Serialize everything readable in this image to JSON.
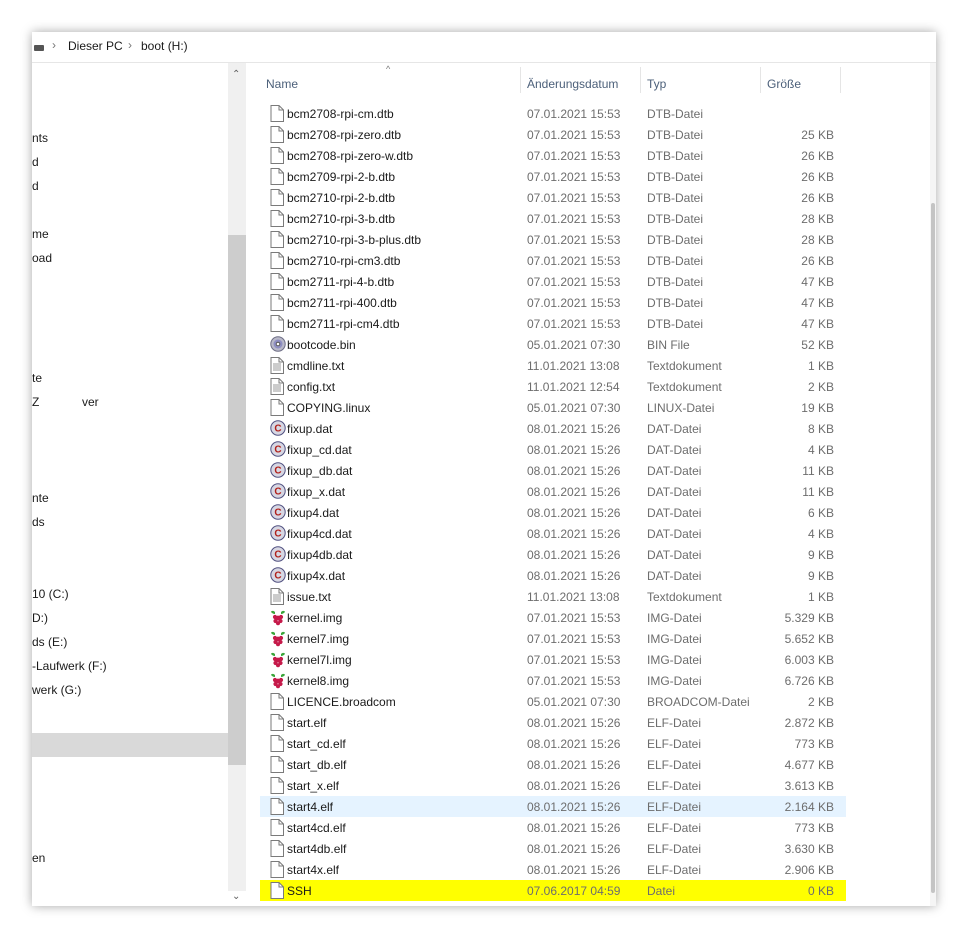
{
  "breadcrumb": {
    "crumb1": "Dieser PC",
    "crumb2": "boot (H:)"
  },
  "nav": {
    "items": [
      "nts",
      "d",
      "d",
      "me",
      "oad",
      "te",
      "Z",
      "ver",
      "nte",
      "ds",
      "10 (C:)",
      "D:)",
      "ds (E:)",
      "-Laufwerk (F:)",
      "werk (G:)",
      "en"
    ]
  },
  "scroll": {
    "up": "⌃",
    "down": "⌄"
  },
  "columns": {
    "name": "Name",
    "date": "Änderungsdatum",
    "type": "Typ",
    "size": "Größe",
    "sort_indicator": "^"
  },
  "files": [
    {
      "name": "bcm2708-rpi-cm.dtb",
      "date": "07.01.2021 15:53",
      "type": "DTB-Datei",
      "size": "",
      "icon": "file"
    },
    {
      "name": "bcm2708-rpi-zero.dtb",
      "date": "07.01.2021 15:53",
      "type": "DTB-Datei",
      "size": "25 KB",
      "icon": "file"
    },
    {
      "name": "bcm2708-rpi-zero-w.dtb",
      "date": "07.01.2021 15:53",
      "type": "DTB-Datei",
      "size": "26 KB",
      "icon": "file"
    },
    {
      "name": "bcm2709-rpi-2-b.dtb",
      "date": "07.01.2021 15:53",
      "type": "DTB-Datei",
      "size": "26 KB",
      "icon": "file"
    },
    {
      "name": "bcm2710-rpi-2-b.dtb",
      "date": "07.01.2021 15:53",
      "type": "DTB-Datei",
      "size": "26 KB",
      "icon": "file"
    },
    {
      "name": "bcm2710-rpi-3-b.dtb",
      "date": "07.01.2021 15:53",
      "type": "DTB-Datei",
      "size": "28 KB",
      "icon": "file"
    },
    {
      "name": "bcm2710-rpi-3-b-plus.dtb",
      "date": "07.01.2021 15:53",
      "type": "DTB-Datei",
      "size": "28 KB",
      "icon": "file"
    },
    {
      "name": "bcm2710-rpi-cm3.dtb",
      "date": "07.01.2021 15:53",
      "type": "DTB-Datei",
      "size": "26 KB",
      "icon": "file"
    },
    {
      "name": "bcm2711-rpi-4-b.dtb",
      "date": "07.01.2021 15:53",
      "type": "DTB-Datei",
      "size": "47 KB",
      "icon": "file"
    },
    {
      "name": "bcm2711-rpi-400.dtb",
      "date": "07.01.2021 15:53",
      "type": "DTB-Datei",
      "size": "47 KB",
      "icon": "file"
    },
    {
      "name": "bcm2711-rpi-cm4.dtb",
      "date": "07.01.2021 15:53",
      "type": "DTB-Datei",
      "size": "47 KB",
      "icon": "file"
    },
    {
      "name": "bootcode.bin",
      "date": "05.01.2021 07:30",
      "type": "BIN File",
      "size": "52 KB",
      "icon": "disc"
    },
    {
      "name": "cmdline.txt",
      "date": "11.01.2021 13:08",
      "type": "Textdokument",
      "size": "1 KB",
      "icon": "text"
    },
    {
      "name": "config.txt",
      "date": "11.01.2021 12:54",
      "type": "Textdokument",
      "size": "2 KB",
      "icon": "text"
    },
    {
      "name": "COPYING.linux",
      "date": "05.01.2021 07:30",
      "type": "LINUX-Datei",
      "size": "19 KB",
      "icon": "file"
    },
    {
      "name": "fixup.dat",
      "date": "08.01.2021 15:26",
      "type": "DAT-Datei",
      "size": "8 KB",
      "icon": "ccleaner"
    },
    {
      "name": "fixup_cd.dat",
      "date": "08.01.2021 15:26",
      "type": "DAT-Datei",
      "size": "4 KB",
      "icon": "ccleaner"
    },
    {
      "name": "fixup_db.dat",
      "date": "08.01.2021 15:26",
      "type": "DAT-Datei",
      "size": "11 KB",
      "icon": "ccleaner"
    },
    {
      "name": "fixup_x.dat",
      "date": "08.01.2021 15:26",
      "type": "DAT-Datei",
      "size": "11 KB",
      "icon": "ccleaner"
    },
    {
      "name": "fixup4.dat",
      "date": "08.01.2021 15:26",
      "type": "DAT-Datei",
      "size": "6 KB",
      "icon": "ccleaner"
    },
    {
      "name": "fixup4cd.dat",
      "date": "08.01.2021 15:26",
      "type": "DAT-Datei",
      "size": "4 KB",
      "icon": "ccleaner"
    },
    {
      "name": "fixup4db.dat",
      "date": "08.01.2021 15:26",
      "type": "DAT-Datei",
      "size": "9 KB",
      "icon": "ccleaner"
    },
    {
      "name": "fixup4x.dat",
      "date": "08.01.2021 15:26",
      "type": "DAT-Datei",
      "size": "9 KB",
      "icon": "ccleaner"
    },
    {
      "name": "issue.txt",
      "date": "11.01.2021 13:08",
      "type": "Textdokument",
      "size": "1 KB",
      "icon": "text"
    },
    {
      "name": "kernel.img",
      "date": "07.01.2021 15:53",
      "type": "IMG-Datei",
      "size": "5.329 KB",
      "icon": "raspberry"
    },
    {
      "name": "kernel7.img",
      "date": "07.01.2021 15:53",
      "type": "IMG-Datei",
      "size": "5.652 KB",
      "icon": "raspberry"
    },
    {
      "name": "kernel7l.img",
      "date": "07.01.2021 15:53",
      "type": "IMG-Datei",
      "size": "6.003 KB",
      "icon": "raspberry"
    },
    {
      "name": "kernel8.img",
      "date": "07.01.2021 15:53",
      "type": "IMG-Datei",
      "size": "6.726 KB",
      "icon": "raspberry"
    },
    {
      "name": "LICENCE.broadcom",
      "date": "05.01.2021 07:30",
      "type": "BROADCOM-Datei",
      "size": "2 KB",
      "icon": "file"
    },
    {
      "name": "start.elf",
      "date": "08.01.2021 15:26",
      "type": "ELF-Datei",
      "size": "2.872 KB",
      "icon": "file"
    },
    {
      "name": "start_cd.elf",
      "date": "08.01.2021 15:26",
      "type": "ELF-Datei",
      "size": "773 KB",
      "icon": "file"
    },
    {
      "name": "start_db.elf",
      "date": "08.01.2021 15:26",
      "type": "ELF-Datei",
      "size": "4.677 KB",
      "icon": "file"
    },
    {
      "name": "start_x.elf",
      "date": "08.01.2021 15:26",
      "type": "ELF-Datei",
      "size": "3.613 KB",
      "icon": "file"
    },
    {
      "name": "start4.elf",
      "date": "08.01.2021 15:26",
      "type": "ELF-Datei",
      "size": "2.164 KB",
      "icon": "file",
      "state": "hover"
    },
    {
      "name": "start4cd.elf",
      "date": "08.01.2021 15:26",
      "type": "ELF-Datei",
      "size": "773 KB",
      "icon": "file"
    },
    {
      "name": "start4db.elf",
      "date": "08.01.2021 15:26",
      "type": "ELF-Datei",
      "size": "3.630 KB",
      "icon": "file"
    },
    {
      "name": "start4x.elf",
      "date": "08.01.2021 15:26",
      "type": "ELF-Datei",
      "size": "2.906 KB",
      "icon": "file"
    },
    {
      "name": "SSH",
      "date": "07.06.2017 04:59",
      "type": "Datei",
      "size": "0 KB",
      "icon": "file",
      "state": "highlighted"
    }
  ],
  "colors": {
    "hover": "#e5f3ff",
    "highlight": "#ffff00",
    "header_text": "#4c607a"
  }
}
